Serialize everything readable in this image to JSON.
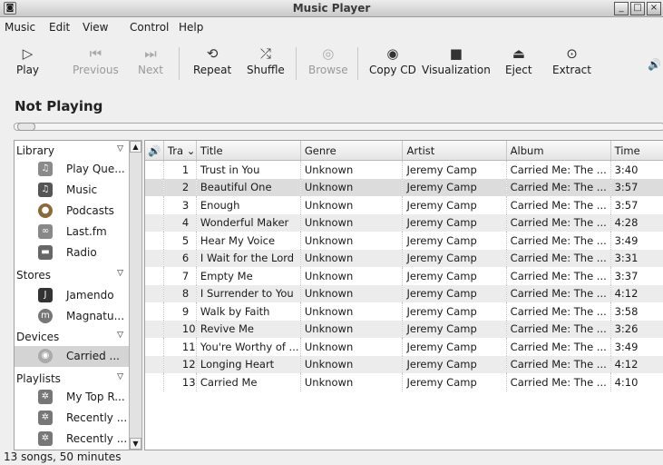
{
  "window": {
    "title": "Music Player"
  },
  "menu": [
    "Music",
    "Edit",
    "View",
    "Control",
    "Help"
  ],
  "toolbar": {
    "play": "Play",
    "previous": "Previous",
    "next": "Next",
    "repeat": "Repeat",
    "shuffle": "Shuffle",
    "browse": "Browse",
    "copy_cd": "Copy CD",
    "visualization": "Visualization",
    "eject": "Eject",
    "extract": "Extract"
  },
  "now_playing": "Not Playing",
  "sidebar": {
    "library": "Library",
    "library_items": [
      "Play Que...",
      "Music",
      "Podcasts",
      "Last.fm",
      "Radio"
    ],
    "stores": "Stores",
    "store_items": [
      "Jamendo",
      "Magnatu..."
    ],
    "devices": "Devices",
    "device_items": [
      "Carried ..."
    ],
    "playlists": "Playlists",
    "playlist_items": [
      "My Top R...",
      "Recently ...",
      "Recently ..."
    ]
  },
  "table": {
    "columns": [
      "Tra",
      "Title",
      "Genre",
      "Artist",
      "Album",
      "Time"
    ],
    "rows": [
      [
        "1",
        "Trust in You",
        "Unknown",
        "Jeremy Camp",
        "Carried Me: The ...",
        "3:40"
      ],
      [
        "2",
        "Beautiful One",
        "Unknown",
        "Jeremy Camp",
        "Carried Me: The ...",
        "3:57"
      ],
      [
        "3",
        "Enough",
        "Unknown",
        "Jeremy Camp",
        "Carried Me: The ...",
        "3:57"
      ],
      [
        "4",
        "Wonderful Maker",
        "Unknown",
        "Jeremy Camp",
        "Carried Me: The ...",
        "4:28"
      ],
      [
        "5",
        "Hear My Voice",
        "Unknown",
        "Jeremy Camp",
        "Carried Me: The ...",
        "3:49"
      ],
      [
        "6",
        "I Wait for the Lord",
        "Unknown",
        "Jeremy Camp",
        "Carried Me: The ...",
        "3:31"
      ],
      [
        "7",
        "Empty Me",
        "Unknown",
        "Jeremy Camp",
        "Carried Me: The ...",
        "3:37"
      ],
      [
        "8",
        "I Surrender to You",
        "Unknown",
        "Jeremy Camp",
        "Carried Me: The ...",
        "4:12"
      ],
      [
        "9",
        "Walk by Faith",
        "Unknown",
        "Jeremy Camp",
        "Carried Me: The ...",
        "3:58"
      ],
      [
        "10",
        "Revive Me",
        "Unknown",
        "Jeremy Camp",
        "Carried Me: The ...",
        "3:26"
      ],
      [
        "11",
        "You're Worthy of ...",
        "Unknown",
        "Jeremy Camp",
        "Carried Me: The ...",
        "3:49"
      ],
      [
        "12",
        "Longing Heart",
        "Unknown",
        "Jeremy Camp",
        "Carried Me: The ...",
        "4:12"
      ],
      [
        "13",
        "Carried Me",
        "Unknown",
        "Jeremy Camp",
        "Carried Me: The ...",
        "4:10"
      ]
    ]
  },
  "status": "13 songs, 50 minutes"
}
